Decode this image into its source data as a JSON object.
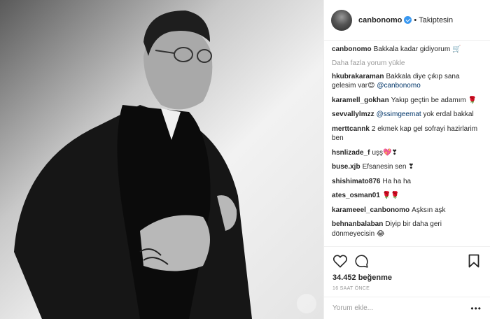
{
  "header": {
    "username": "canbonomo",
    "separator": "•",
    "follow_status": "Takiptesin"
  },
  "caption": {
    "user": "canbonomo",
    "text": "Bakkala kadar gidiyorum 🛒"
  },
  "load_more": "Daha fazla yorum yükle",
  "comments": [
    {
      "user": "hkubrakaraman",
      "text": "Bakkala diye çıkıp sana gelesim var😊",
      "mention": "@canbonomo",
      "after": ""
    },
    {
      "user": "karamell_gokhan",
      "text": "Yakıp geçtin be adamım 🌹",
      "mention": "",
      "after": ""
    },
    {
      "user": "sevvallylmzz",
      "text": "",
      "mention": "@ssimgeemat",
      "after": "yok erdal bakkal"
    },
    {
      "user": "merttcannk",
      "text": "2 ekmek kap gel sofrayi hazirlarim ben",
      "mention": "",
      "after": ""
    },
    {
      "user": "hsnlizade_f",
      "text": "uşş💖❣",
      "mention": "",
      "after": ""
    },
    {
      "user": "buse.xjb",
      "text": "Efsanesin sen ❣",
      "mention": "",
      "after": ""
    },
    {
      "user": "shishimato876",
      "text": "Ha ha ha",
      "mention": "",
      "after": ""
    },
    {
      "user": "ates_osman01",
      "text": "🌹🌹",
      "mention": "",
      "after": ""
    },
    {
      "user": "karameeel_canbonomo",
      "text": "Aşksın aşk",
      "mention": "",
      "after": ""
    },
    {
      "user": "behnanbalaban",
      "text": "Diyip bir daha geri dönmeyecisin 😂",
      "mention": "",
      "after": ""
    }
  ],
  "likes": "34.452 beğenme",
  "timestamp": "16 SAAT ÖNCE",
  "add_comment_placeholder": "Yorum ekle...",
  "more_options": "•••",
  "icons": {
    "like": "heart-icon",
    "comment": "comment-icon",
    "save": "bookmark-icon",
    "verified": "verified-badge-icon",
    "options": "more-options-icon"
  },
  "colors": {
    "link": "#003569",
    "verified": "#3897f0",
    "muted": "#999999"
  }
}
